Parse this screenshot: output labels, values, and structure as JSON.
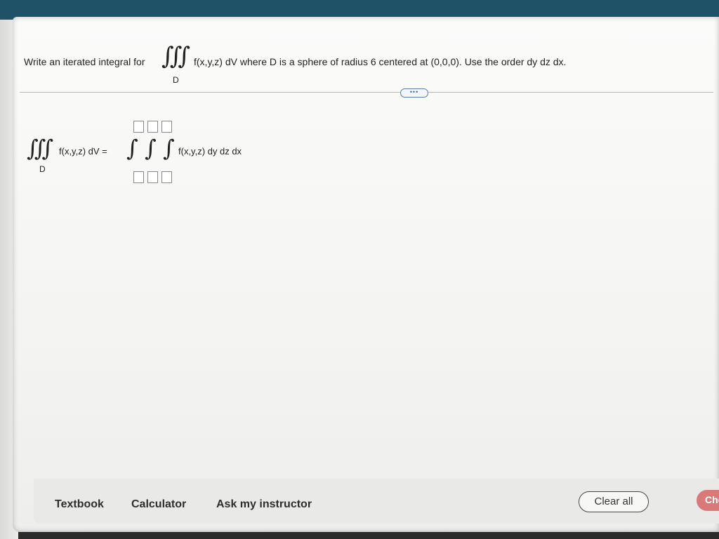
{
  "question": {
    "prefix": "Write an iterated integral for",
    "integral_symbol": "∫∫∫",
    "region": "D",
    "suffix": "f(x,y,z) dV where D is a sphere of radius 6 centered at (0,0,0). Use the order dy dz dx."
  },
  "divider": {
    "more_label": "•••"
  },
  "answer": {
    "left_integral": "∫∫∫",
    "left_region": "D",
    "lhs": "f(x,y,z) dV =",
    "single_integral": "∫",
    "rhs": "f(x,y,z) dy dz dx",
    "upper_limits": [
      "",
      "",
      ""
    ],
    "lower_limits": [
      "",
      "",
      ""
    ]
  },
  "footer": {
    "textbook": "Textbook",
    "calculator": "Calculator",
    "ask_instructor": "Ask my instructor",
    "clear_all": "Clear all",
    "check": "Chec"
  },
  "colors": {
    "top_bar": "#1f5266",
    "check_button": "#d97a7a",
    "more_pill_border": "#5e7fa8"
  }
}
